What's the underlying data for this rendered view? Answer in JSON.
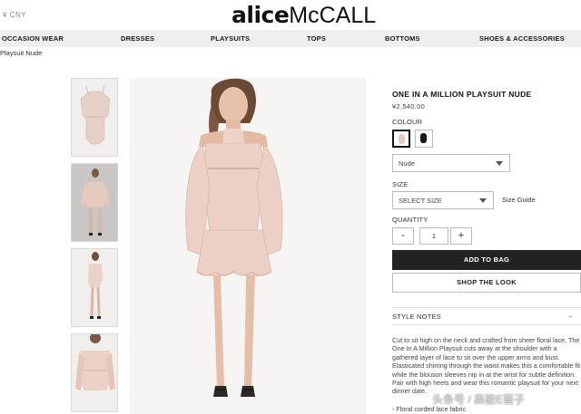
{
  "header": {
    "currency": "¥ CNY",
    "logo": {
      "part1": "alice",
      "part2": "McCALL"
    }
  },
  "nav": {
    "items": [
      {
        "label": "OCCASION WEAR"
      },
      {
        "label": "DRESSES"
      },
      {
        "label": "PLAYSUITS"
      },
      {
        "label": "TOPS"
      },
      {
        "label": "BOTTOMS"
      },
      {
        "label": "SHOES & ACCESSORIES"
      }
    ]
  },
  "breadcrumb": "Playsuit Nude",
  "gallery": {
    "thumbnails": [
      {
        "name": "thumbnail-flat-lay",
        "active": false
      },
      {
        "name": "thumbnail-model-front",
        "active": true
      },
      {
        "name": "thumbnail-model-full",
        "active": false
      },
      {
        "name": "thumbnail-model-closeup",
        "active": false
      }
    ]
  },
  "product": {
    "title": "ONE IN A MILLION PLAYSUIT NUDE",
    "price": "¥2,540.00",
    "colour_label": "COLOUR",
    "swatches": [
      {
        "name": "nude",
        "color": "#e8c9c0",
        "selected": true
      },
      {
        "name": "black",
        "color": "#1a1a1a",
        "selected": false
      }
    ],
    "colour_select_value": "Nude",
    "size_label": "SIZE",
    "size_select_placeholder": "SELECT SIZE",
    "size_guide": "Size Guide",
    "quantity_label": "QUANTITY",
    "quantity_minus": "-",
    "quantity_value": "1",
    "quantity_plus": "+",
    "add_to_bag": "ADD TO BAG",
    "shop_the_look": "SHOP THE LOOK",
    "style_notes_heading": "STYLE NOTES",
    "style_notes_toggle": "-",
    "style_notes_text": "Cut to sit high on the neck and crafted from sheer floral lace, The One In A Million Playsuit cuts away at the shoulder with a gathered layer of lace to sit over the upper arms and bust. Elasticated shirring through the waist makes this a comfortable fit while the blouson sleeves nip in at the wrist for subtle definition. Pair with high heels and wear this romantic playsuit for your next dinner date.",
    "style_notes_bullet": "- Floral corded lace fabric"
  },
  "watermark": "头条号 / 高能E窖子",
  "colors": {
    "nav_bg": "#efefef",
    "button_dark": "#222222",
    "dress_nude": "#ecd0c6"
  }
}
